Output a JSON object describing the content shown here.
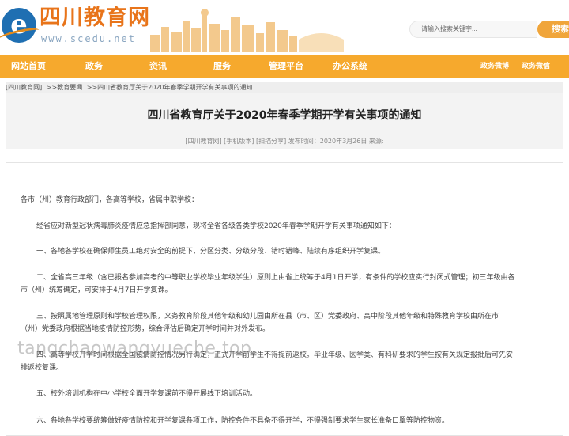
{
  "header": {
    "logo_letter": "e",
    "site_name": "四川教育网",
    "site_url": "www.scedu.net",
    "search_placeholder": "请输入搜索关键字...",
    "search_button": "搜索"
  },
  "nav": {
    "items": [
      "网站首页",
      "政务",
      "资讯",
      "服务",
      "管理平台",
      "办公系统"
    ],
    "right_items": [
      "政务微博",
      "政务微信"
    ]
  },
  "breadcrumb": [
    "[四川教育网]",
    ">>教育要闻",
    ">>四川省教育厅关于2020年春季学期开学有关事项的通知"
  ],
  "article": {
    "title": "四川省教育厅关于2020年春季学期开学有关事项的通知",
    "meta": "[四川教育网]  [手机版本]  [扫描分享]  发布时间：2020年3月26日  来源:",
    "paragraphs": [
      "各市（州）教育行政部门，各高等学校，省属中职学校：",
      "经省应对新型冠状病毒肺炎疫情应急指挥部同意，现将全省各级各类学校2020年春季学期开学有关事项通知如下：",
      "一、各地各学校在确保师生员工绝对安全的前提下，分区分类、分级分段、错时错峰、陆续有序组织开学复课。",
      "二、全省高三年级（含已报名参加高考的中等职业学校毕业年级学生）原则上由省上统筹于4月1日开学，有条件的学校应实行封闭式管理；初三年级由各",
      "市（州）统筹确定，可安排于4月7日开学复课。",
      "三、按照属地管理原则和学校管理权限，义务教育阶段其他年级和幼儿园由所在县（市、区）党委政府、高中阶段其他年级和特殊教育学校由所在市",
      "（州）党委政府根据当地疫情防控形势，综合评估后确定开学时间并对外发布。",
      "四、高等学校开学时间根据全国疫情防控情况另行确定，正式开学前学生不得提前返校。毕业年级、医学类、有科研要求的学生按有关规定报批后可先安",
      "排返校复课。",
      "五、校外培训机构在中小学校全面开学复课前不得开展线下培训活动。",
      "六、各地各学校要统筹做好疫情防控和开学复课各项工作，防控条件不具备不得开学，不得强制要求学生家长准备口罩等防控物资。"
    ]
  },
  "watermark": "tangchaowangyueche.top",
  "colors": {
    "brand_orange": "#e8741a",
    "nav_bg": "#f6a92d",
    "logo_blue": "#1f6fb2"
  }
}
